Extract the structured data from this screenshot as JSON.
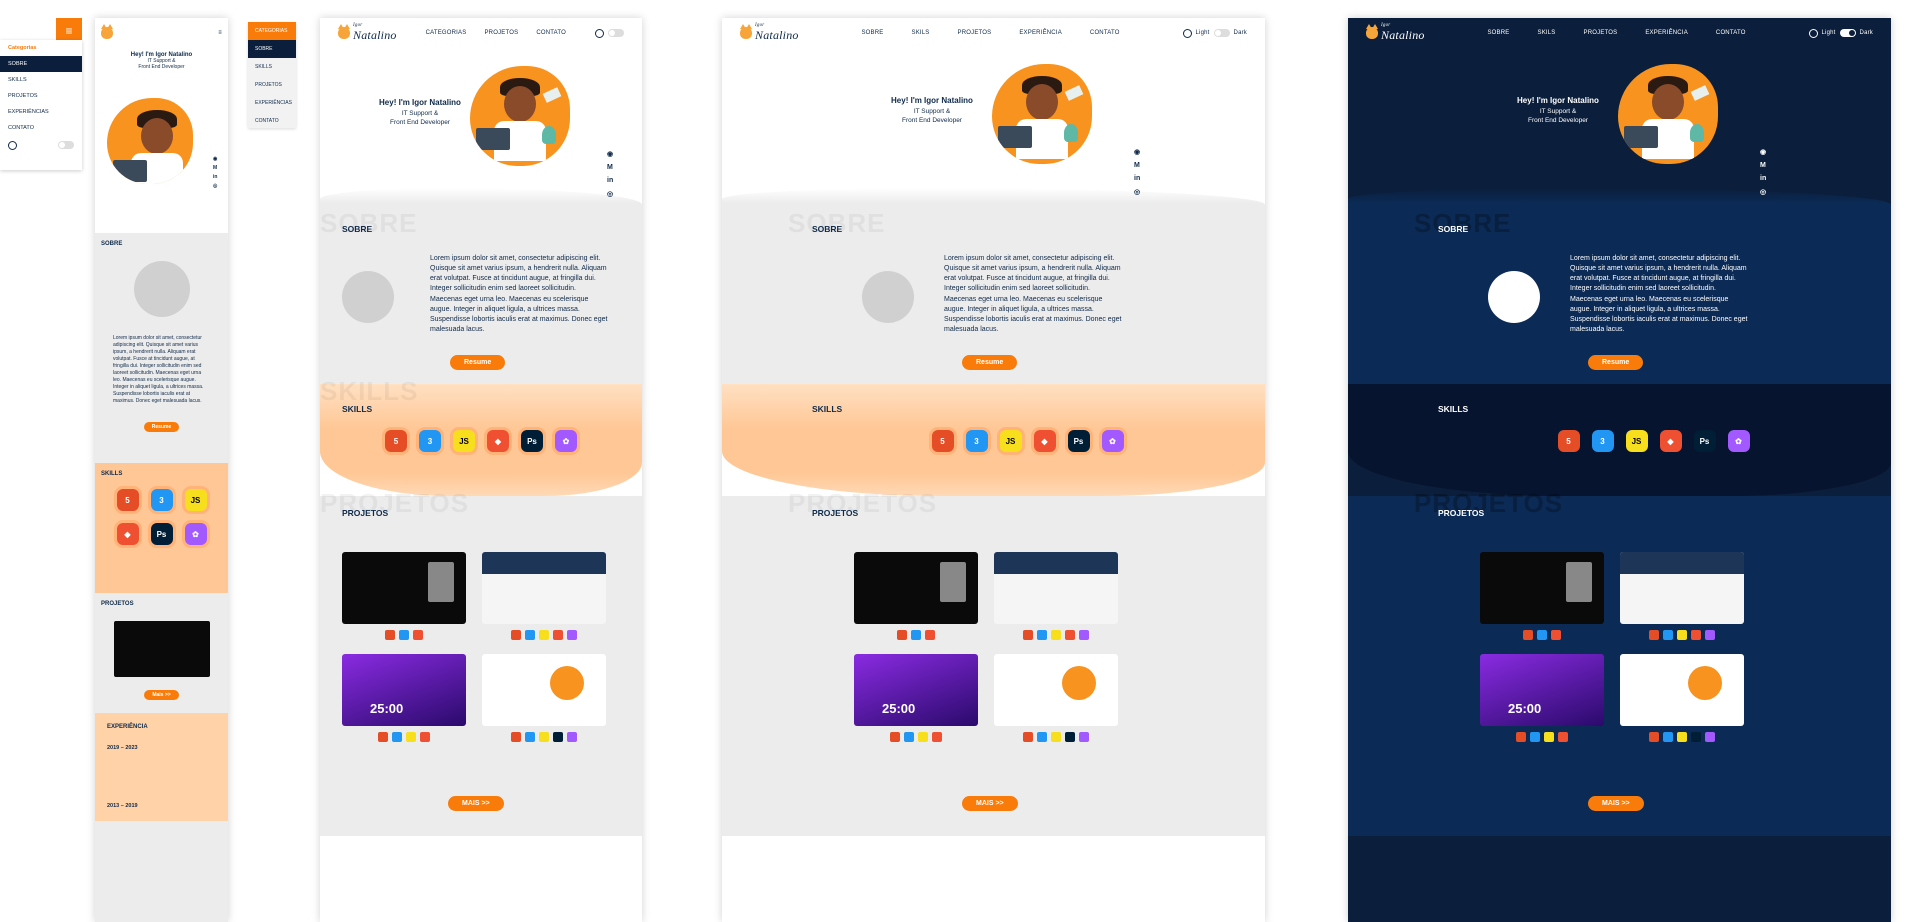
{
  "colors": {
    "accent": "#f97c0b",
    "navy": "#0b1e3b",
    "light_bg": "#ececec",
    "skills_bg": "#ffc796"
  },
  "logo": {
    "small": "Igor",
    "name": "Natalino"
  },
  "mobile_menu": {
    "header": "Categorias",
    "items": [
      "SOBRE",
      "SKILLS",
      "PROJETOS",
      "EXPERIÊNCIAS",
      "CONTATO"
    ]
  },
  "dropdown": {
    "header": "CATEGORIAS",
    "items": [
      "SOBRE",
      "SKILLS",
      "PROJETOS",
      "EXPERIÊNCIAS",
      "CONTATO"
    ]
  },
  "nav_short": [
    "CATEGORIAS",
    "PROJETOS",
    "CONTATO"
  ],
  "nav_full": [
    "SOBRE",
    "SKILS",
    "PROJETOS",
    "EXPERIÊNCIA",
    "CONTATO"
  ],
  "theme": {
    "light": "Light",
    "dark": "Dark"
  },
  "hero": {
    "greeting": "Hey! I'm Igor Natalino",
    "role_line1": "IT Support &",
    "role_line2": "Front End Developer"
  },
  "social": [
    "github",
    "gmail",
    "in",
    "instagram"
  ],
  "sobre": {
    "title": "SOBRE",
    "lorem": "Lorem ipsum dolor sit amet, consectetur adipiscing elit. Quisque sit amet varius ipsum, a hendrerit nulla. Aliquam erat volutpat. Fusce at tincidunt augue, at fringilla dui. Integer sollicitudin enim sed laoreet sollicitudin. Maecenas eget urna leo. Maecenas eu scelerisque augue. Integer in aliquet ligula, a ultrices massa. Suspendisse lobortis iaculis erat at maximus. Donec eget malesuada lacus.",
    "button": "Resume"
  },
  "skills": {
    "title": "SKILLS",
    "icons": [
      {
        "name": "html5-icon",
        "glyph": "5",
        "color": "#e44d26"
      },
      {
        "name": "css3-icon",
        "glyph": "3",
        "color": "#2196f3"
      },
      {
        "name": "javascript-icon",
        "glyph": "JS",
        "color": "#f7df1e"
      },
      {
        "name": "git-icon",
        "glyph": "◆",
        "color": "#f05032"
      },
      {
        "name": "photoshop-icon",
        "glyph": "Ps",
        "color": "#001e36"
      },
      {
        "name": "figma-icon",
        "glyph": "✿",
        "color": "#a259ff"
      }
    ]
  },
  "projetos": {
    "title": "PROJETOS",
    "button": "MAIS >>",
    "big_time": "25:00"
  },
  "mobile": {
    "mais": "Mais >>",
    "exp_title": "EXPERIÊNCIA",
    "exp1_date": "2019 – 2023",
    "exp2_date": "2013 – 2019"
  }
}
